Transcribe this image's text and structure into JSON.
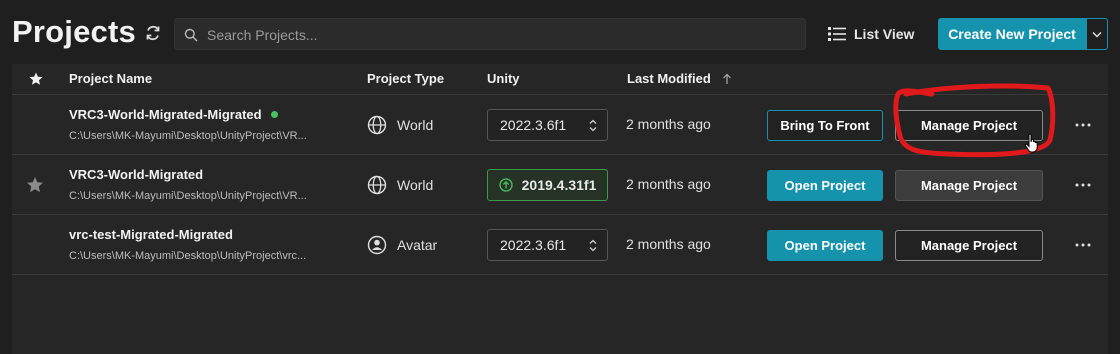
{
  "header": {
    "title": "Projects",
    "search_placeholder": "Search Projects...",
    "list_view_label": "List View",
    "create_label": "Create New Project"
  },
  "table": {
    "columns": {
      "name": "Project Name",
      "type": "Project Type",
      "unity": "Unity",
      "modified": "Last Modified"
    },
    "rows": [
      {
        "name": "VRC3-World-Migrated-Migrated",
        "path": "C:\\Users\\MK-Mayumi\\Desktop\\UnityProject\\VR...",
        "type": "World",
        "unity": "2022.3.6f1",
        "modified": "2 months ago",
        "primary_action": "Bring To Front",
        "manage": "Manage Project"
      },
      {
        "name": "VRC3-World-Migrated",
        "path": "C:\\Users\\MK-Mayumi\\Desktop\\UnityProject\\VR...",
        "type": "World",
        "unity": "2019.4.31f1",
        "modified": "2 months ago",
        "primary_action": "Open Project",
        "manage": "Manage Project"
      },
      {
        "name": "vrc-test-Migrated-Migrated",
        "path": "C:\\Users\\MK-Mayumi\\Desktop\\UnityProject\\vrc...",
        "type": "Avatar",
        "unity": "2022.3.6f1",
        "modified": "2 months ago",
        "primary_action": "Open Project",
        "manage": "Manage Project"
      }
    ]
  },
  "colors": {
    "accent": "#1592ac",
    "running": "#4ac15e",
    "upgrade": "#3c9a4c",
    "annotation": "#e0191c"
  },
  "icons": [
    "refresh-icon",
    "search-icon",
    "list-icon",
    "chevron-down-icon",
    "star-icon",
    "globe-icon",
    "avatar-icon",
    "updown-icon",
    "arrow-up-circle-icon",
    "more-icon",
    "sort-up-icon",
    "hand-cursor-icon"
  ]
}
